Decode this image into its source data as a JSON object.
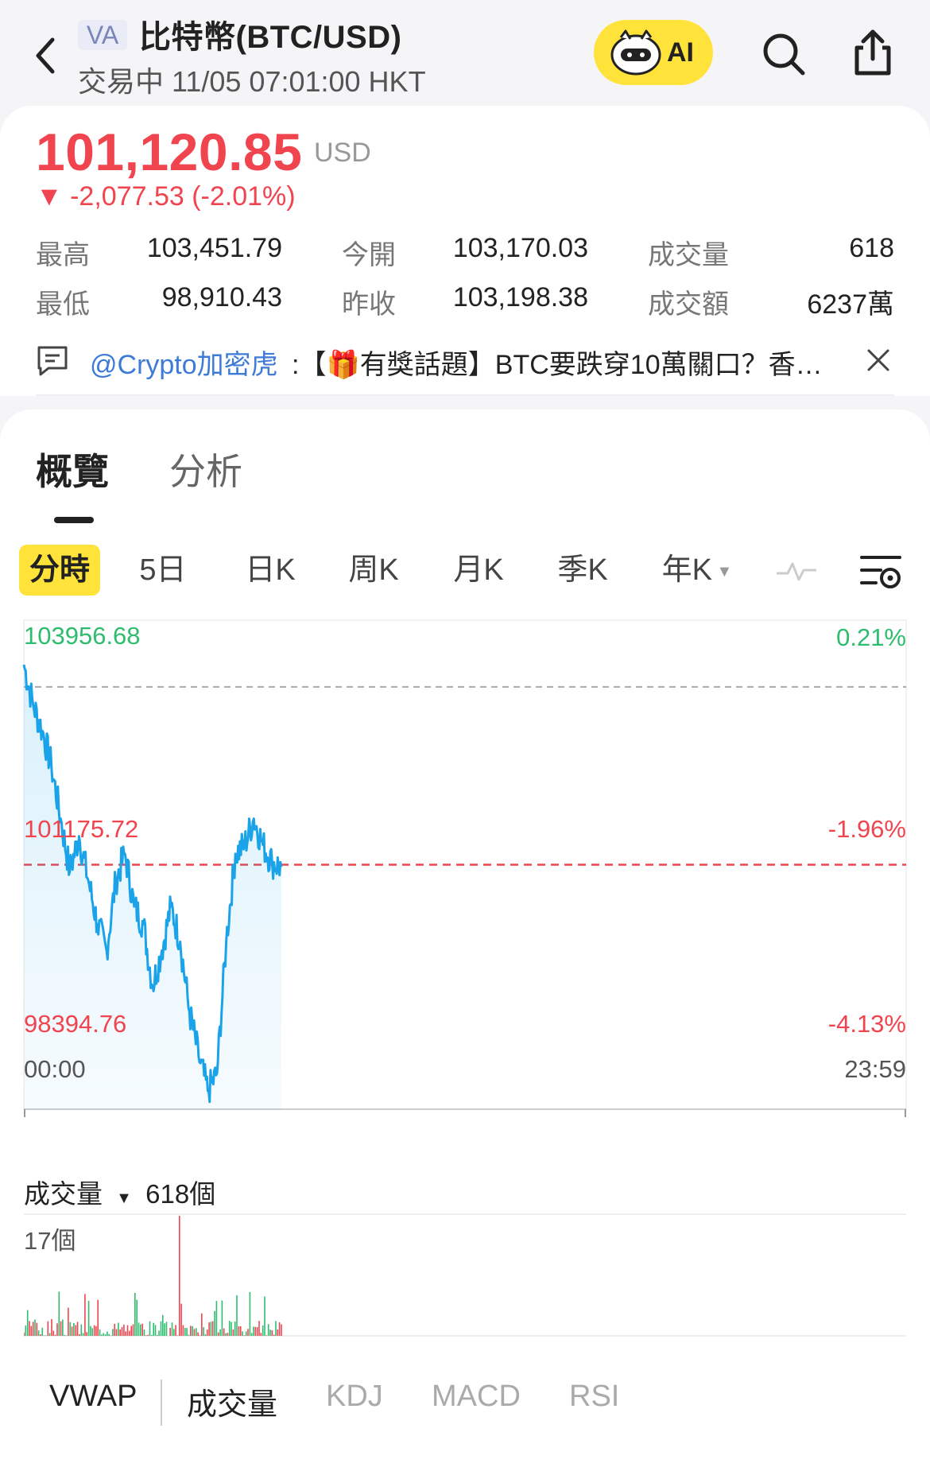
{
  "header": {
    "badge": "VA",
    "title": "比特幣(BTC/USD)",
    "status_line": "交易中 11/05 07:01:00 HKT",
    "ai_label": "AI",
    "icons": [
      "back-chevron-icon",
      "ai-mascot-icon",
      "search-icon",
      "share-icon"
    ]
  },
  "quote": {
    "price": "101,120.85",
    "currency": "USD",
    "change": "▼ -2,077.53 (-2.01%)",
    "colors": {
      "down": "#f0444f",
      "up": "#2ebc6f",
      "accent": "#ffe23a",
      "line": "#1aa3e8"
    },
    "stats": [
      {
        "label": "最高",
        "value": "103,451.79"
      },
      {
        "label": "今開",
        "value": "103,170.03"
      },
      {
        "label": "成交量",
        "value": "618"
      },
      {
        "label": "最低",
        "value": "98,910.43"
      },
      {
        "label": "昨收",
        "value": "103,198.38"
      },
      {
        "label": "成交額",
        "value": "6237萬"
      }
    ]
  },
  "news": {
    "user": "@Crypto加密虎",
    "text": ":【🎁有獎話題】BTC要跌穿10萬關口？香…"
  },
  "tabs": [
    "概覽",
    "分析"
  ],
  "periods": [
    "分時",
    "5日",
    "日K",
    "周K",
    "月K",
    "季K",
    "年K"
  ],
  "chart": {
    "high_price": "103956.68",
    "high_pct": "0.21%",
    "ref_price": "101175.72",
    "ref_pct": "-1.96%",
    "low_price": "98394.76",
    "low_pct": "-4.13%",
    "start_time": "00:00",
    "end_time": "23:59"
  },
  "volume": {
    "label": "成交量",
    "total": "618個",
    "max": "17個"
  },
  "indicators": [
    "VWAP",
    "成交量",
    "KDJ",
    "MACD",
    "RSI"
  ],
  "chart_data": {
    "type": "line",
    "title": "",
    "xlabel": "",
    "ylabel": "",
    "x_range": [
      "00:00",
      "23:59"
    ],
    "ylim": [
      98394.76,
      103956.68
    ],
    "reference_line": 101175.72,
    "previous_close_line": 103198.38,
    "series": [
      {
        "x": [
          "00:00",
          "00:15",
          "00:30",
          "00:45",
          "01:00",
          "01:15",
          "01:30",
          "01:45",
          "02:00",
          "02:15",
          "02:30",
          "02:45",
          "03:00",
          "03:15",
          "03:30",
          "03:45",
          "04:00",
          "04:15",
          "04:30",
          "04:45",
          "05:00",
          "05:15",
          "05:30",
          "05:45",
          "06:00",
          "06:15",
          "06:30",
          "06:45",
          "07:00"
        ],
        "values": [
          103450,
          103000,
          102700,
          102300,
          101700,
          101100,
          101500,
          101000,
          100500,
          100200,
          101000,
          101300,
          100700,
          100500,
          99800,
          100200,
          100700,
          100300,
          99500,
          99000,
          98600,
          98800,
          100300,
          101300,
          101400,
          101700,
          101400,
          101200,
          101150
        ]
      }
    ],
    "volume_series": {
      "ymax": 17,
      "spike": {
        "x": "04:15",
        "value": 17
      }
    }
  }
}
